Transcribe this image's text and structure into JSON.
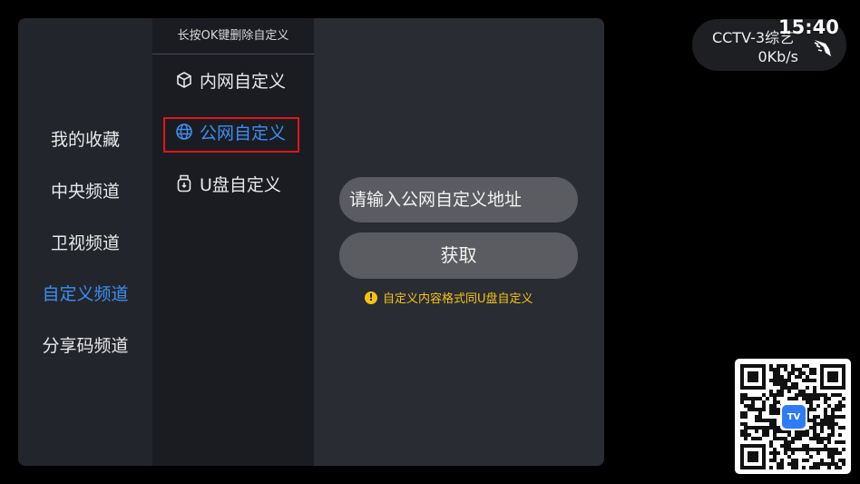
{
  "categories": [
    {
      "label": "我的收藏",
      "active": false
    },
    {
      "label": "中央频道",
      "active": false
    },
    {
      "label": "卫视频道",
      "active": false
    },
    {
      "label": "自定义频道",
      "active": true
    },
    {
      "label": "分享码频道",
      "active": false
    }
  ],
  "sub_menu": {
    "hint": "长按OK键删除自定义",
    "items": [
      {
        "label": "内网自定义",
        "icon": "cube-icon",
        "active": false
      },
      {
        "label": "公网自定义",
        "icon": "globe-icon",
        "active": true
      },
      {
        "label": "U盘自定义",
        "icon": "usb-drive-icon",
        "active": false
      }
    ]
  },
  "content": {
    "input_placeholder": "请输入公网自定义地址",
    "get_button_label": "获取",
    "note_icon": "warning-icon",
    "note_text": "自定义内容格式同U盘自定义"
  },
  "status": {
    "channel_name": "CCTV-3综艺",
    "speed": "0Kb/s",
    "time": "15:40"
  },
  "qr": {
    "logo_text": "TV"
  },
  "colors": {
    "accent": "#3d8ef0",
    "focus_border": "#e0141b",
    "warning": "#f3c31a"
  }
}
